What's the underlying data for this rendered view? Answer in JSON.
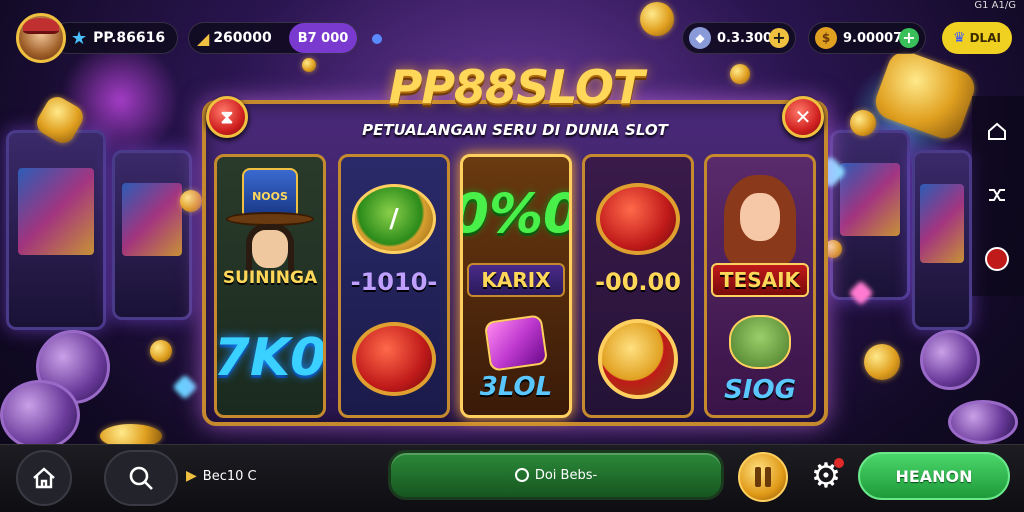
{
  "status_bar": {
    "clock": "G1 A1/G"
  },
  "player": {
    "name": "PP.86616",
    "star_icon": "star-icon"
  },
  "currency": {
    "gold": "260000",
    "gold_badge": "B7 000",
    "gems": "0.3.300",
    "coins": "9.00007",
    "vip_label": "DLAI"
  },
  "game": {
    "title": "PP88SLOT",
    "subtitle": "PETUALANGAN SERU DI DUNIA SLOT"
  },
  "reels": [
    {
      "top_label": "SUININGA",
      "hat_text": "NOOS",
      "bottom_label": "7K0"
    },
    {
      "middle_label": "-1010-"
    },
    {
      "top_label": "0%0",
      "middle_label": "KARIX",
      "bottom_label": "3LOL"
    },
    {
      "middle_label": "-00.00"
    },
    {
      "middle_label": "TESAIK",
      "bottom_label": "SIOG"
    }
  ],
  "bottom_bar": {
    "bet_label": "Bec10 C",
    "play_label": "Doi Bebs-",
    "spin_label": "HEANON"
  },
  "colors": {
    "accent_gold": "#f0c040",
    "play_green": "#2b8a3a",
    "spin_green": "#3ac05a",
    "badge_purple": "#7a3ad0"
  }
}
